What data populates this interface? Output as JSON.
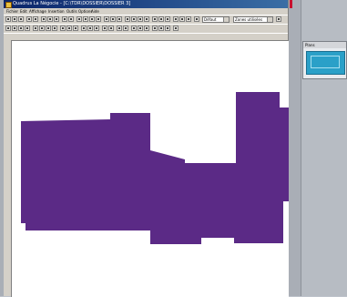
{
  "window": {
    "title": "Quadrus La Négocie - [C:\\TDR\\DOSSIER\\DOSSIER 3]"
  },
  "menu": {
    "items": [
      "Fichier",
      "Edit",
      "Affichage",
      "Insertion",
      "Outils",
      "Options",
      "Aide"
    ]
  },
  "toolbar": {
    "combo1_value": "Défaut",
    "combo2_value": "Zones utilisées"
  },
  "dock_panel": {
    "title": "Plans"
  },
  "colors": {
    "shape_fill": "#5b2a86",
    "canvas_bg": "#ffffff",
    "panel_thumb": "#2aa0c8"
  }
}
